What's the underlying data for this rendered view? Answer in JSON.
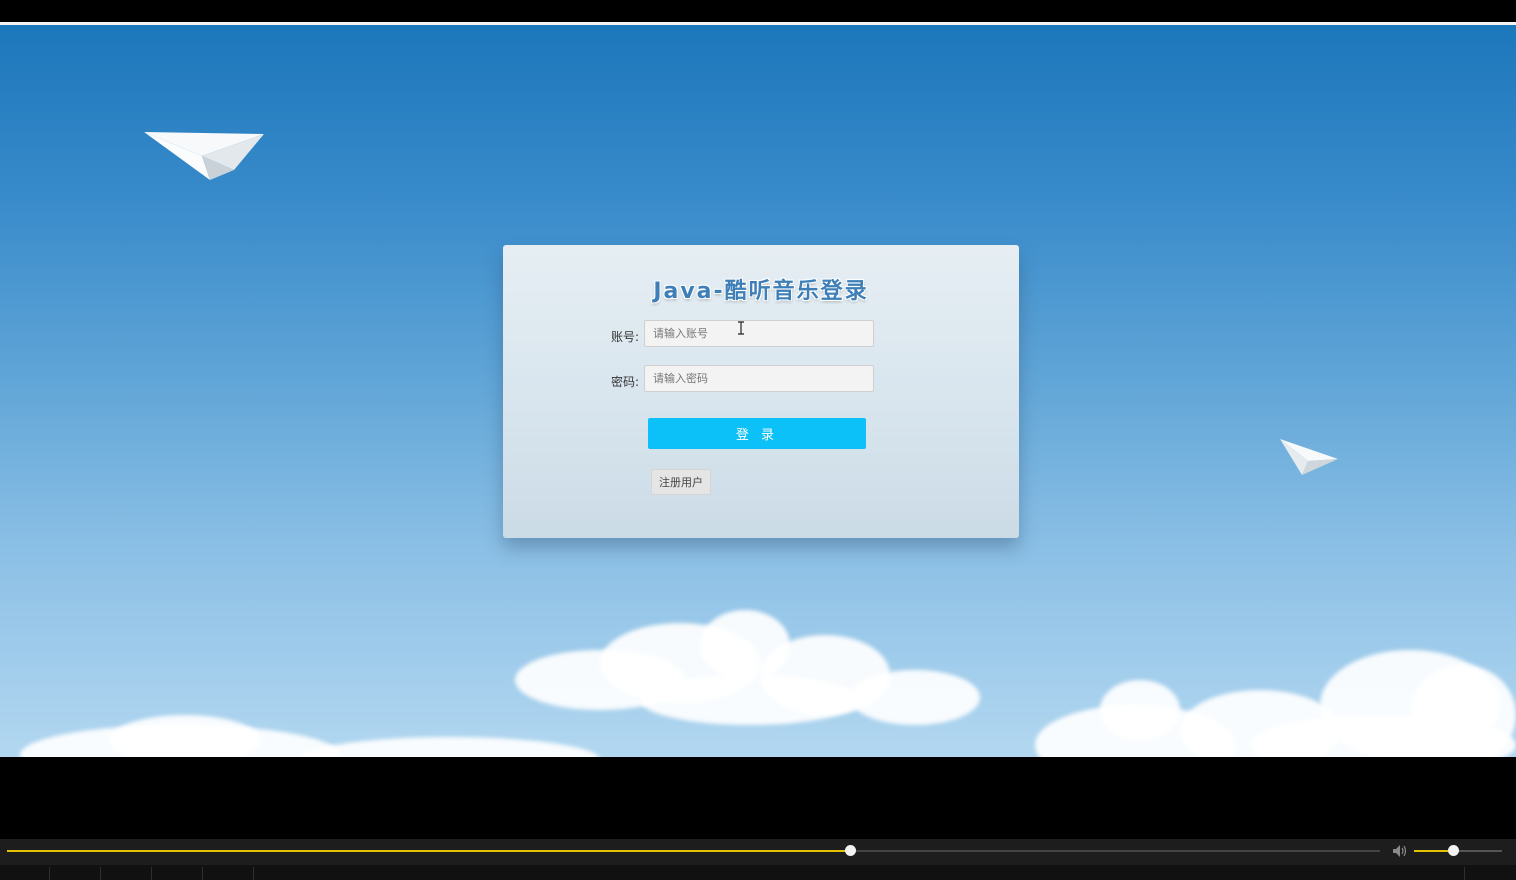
{
  "login": {
    "title": "Java-酷听音乐登录",
    "account_label": "账号:",
    "account_placeholder": "请输入账号",
    "account_value": "",
    "password_label": "密码:",
    "password_placeholder": "请输入密码",
    "password_value": "",
    "login_label": "登 录",
    "register_label": "注册用户"
  },
  "player": {
    "progress": 0.614,
    "volume": 0.44
  },
  "colors": {
    "login_button": "#0cc1f7",
    "title": "#3e7fb8",
    "progress_accent": "#e5c200"
  }
}
